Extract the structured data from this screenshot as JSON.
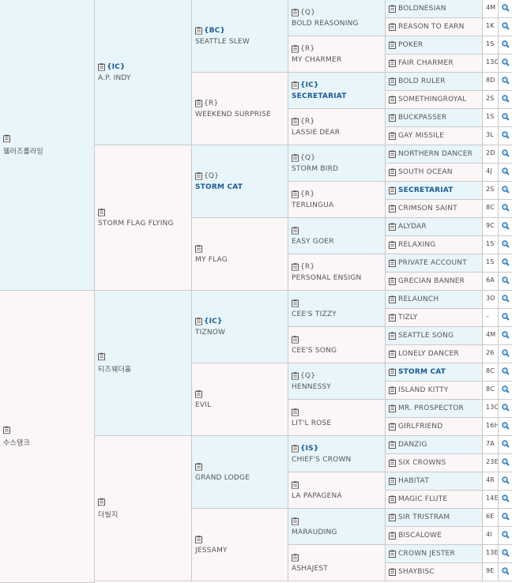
{
  "g1": [
    {
      "name": "웰러즈플라잉",
      "tag": ""
    },
    {
      "name": "수스탱크",
      "tag": ""
    }
  ],
  "g2": [
    {
      "name": "A.P. INDY",
      "tag": "{IC}"
    },
    {
      "name": "STORM FLAG FLYING",
      "tag": ""
    },
    {
      "name": "티즈웨더홀",
      "tag": ""
    },
    {
      "name": "더빌지",
      "tag": ""
    }
  ],
  "g3": [
    {
      "name": "SEATTLE SLEW",
      "tag": "{BC}"
    },
    {
      "name": "WEEKEND SURPRISE",
      "tag": "{R}"
    },
    {
      "name": "STORM CAT",
      "tag": "{Q}"
    },
    {
      "name": "MY FLAG",
      "tag": ""
    },
    {
      "name": "TIZNOW",
      "tag": "{IC}"
    },
    {
      "name": "EVIL",
      "tag": ""
    },
    {
      "name": "GRAND LODGE",
      "tag": ""
    },
    {
      "name": "JESSAMY",
      "tag": ""
    }
  ],
  "g4": [
    {
      "name": "BOLD REASONING",
      "tag": "{Q}"
    },
    {
      "name": "MY CHARMER",
      "tag": "{R}"
    },
    {
      "name": "SECRETARIAT",
      "tag": "{IC}"
    },
    {
      "name": "LASSIE DEAR",
      "tag": "{R}"
    },
    {
      "name": "STORM BIRD",
      "tag": "{Q}"
    },
    {
      "name": "TERLINGUA",
      "tag": "{R}"
    },
    {
      "name": "EASY GOER",
      "tag": ""
    },
    {
      "name": "PERSONAL ENSIGN",
      "tag": "{R}"
    },
    {
      "name": "CEE'S TIZZY",
      "tag": ""
    },
    {
      "name": "CEE'S SONG",
      "tag": ""
    },
    {
      "name": "HENNESSY",
      "tag": "{Q}"
    },
    {
      "name": "LIT'L ROSE",
      "tag": ""
    },
    {
      "name": "CHIEF'S CROWN",
      "tag": "{IS}"
    },
    {
      "name": "LA PAPAGENA",
      "tag": ""
    },
    {
      "name": "MARAUDING",
      "tag": ""
    },
    {
      "name": "ASHAJEST",
      "tag": ""
    }
  ],
  "g5": [
    {
      "name": "BOLDNESIAN",
      "num": "4M"
    },
    {
      "name": "REASON TO EARN",
      "num": "1K"
    },
    {
      "name": "POKER",
      "num": "1S"
    },
    {
      "name": "FAIR CHARMER",
      "num": "13C"
    },
    {
      "name": "BOLD RULER",
      "num": "8D"
    },
    {
      "name": "SOMETHINGROYAL",
      "num": "2S"
    },
    {
      "name": "BUCKPASSER",
      "num": "1S"
    },
    {
      "name": "GAY MISSILE",
      "num": "3L"
    },
    {
      "name": "NORTHERN DANCER",
      "num": "2D"
    },
    {
      "name": "SOUTH OCEAN",
      "num": "4J"
    },
    {
      "name": "SECRETARIAT",
      "num": "2S"
    },
    {
      "name": "CRIMSON SAINT",
      "num": "8C"
    },
    {
      "name": "ALYDAR",
      "num": "9C"
    },
    {
      "name": "RELAXING",
      "num": "1S"
    },
    {
      "name": "PRIVATE ACCOUNT",
      "num": "1S"
    },
    {
      "name": "GRECIAN BANNER",
      "num": "6A"
    },
    {
      "name": "RELAUNCH",
      "num": "3O"
    },
    {
      "name": "TIZLY",
      "num": "–"
    },
    {
      "name": "SEATTLE SONG",
      "num": "4M"
    },
    {
      "name": "LONELY DANCER",
      "num": "26"
    },
    {
      "name": "STORM CAT",
      "num": "8C"
    },
    {
      "name": "ISLAND KITTY",
      "num": "8C"
    },
    {
      "name": "MR. PROSPECTOR",
      "num": "13C"
    },
    {
      "name": "GIRLFRIEND",
      "num": "16H"
    },
    {
      "name": "DANZIG",
      "num": "7A"
    },
    {
      "name": "SIX CROWNS",
      "num": "23E"
    },
    {
      "name": "HABITAT",
      "num": "4R"
    },
    {
      "name": "MAGIC FLUTE",
      "num": "14E"
    },
    {
      "name": "SIR TRISTRAM",
      "num": "6E"
    },
    {
      "name": "BISCALOWE",
      "num": "4I"
    },
    {
      "name": "CROWN JESTER",
      "num": "13E"
    },
    {
      "name": "SHAYBISC",
      "num": "9E"
    }
  ],
  "colors": {
    "male_bg": "#e8f6fc",
    "female_bg": "#fdf6f6",
    "link_blue": "#1a5a9a",
    "border": "#c9c9c9"
  },
  "icons": {
    "record": "clipboard-icon",
    "search": "magnifier-icon"
  }
}
